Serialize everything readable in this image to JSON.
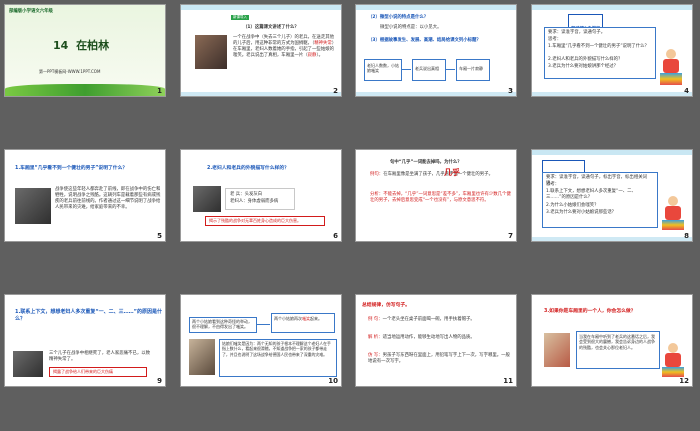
{
  "slides": [
    {
      "number": "1",
      "series": "部编版小学语文六年级",
      "lesson_num": "14",
      "lesson_title": "在柏林",
      "website": "第一PPT模板网-WWW.1PPT.COM"
    },
    {
      "number": "2",
      "tag": "新课导入",
      "question": "（1）这篇课文讲述了什么？",
      "body_a": "一个在战争中（失去三个儿子）的老兵，在送走其他的儿子后，用这种非常的方式为国捐躯，（",
      "body_b": "精神失常",
      "body_c": "）在车厢里，老妇人数着她的手指，引起了一些姑娘的嗤笑。老兵说出了真相，车厢里一片（",
      "body_d": "寂静",
      "body_e": "）。"
    },
    {
      "number": "3",
      "q1": "（2）微型小说的特点是什么？",
      "a1": "微型小说的特点是：以小见大。",
      "q2": "（3）根据故事发生、发展、高潮、结局给课文列小标题？",
      "flow": [
        "老妇人数数，小姑娘嗤笑",
        "老兵说出真相",
        "车厢一片寂静"
      ]
    },
    {
      "number": "4",
      "title": "朗读第1自然段",
      "lines": [
        "要求：读准字音，读通句子。",
        "思考：",
        "1.车厢里“几乎看不到一个健壮的男子”说明了什么？",
        "2.老妇人和老兵的外貌描写什么样的？",
        "3.老兵为什么要对姑娘讲那个经过？"
      ]
    },
    {
      "number": "5",
      "question": "1.车厢里“几乎看不到一个健壮的男子”说明了什么？",
      "answer": "战争使这些年轻人都奔赴了前线，即在战争中的伤亡和牺牲，说明战争之残酷。这辆列车是载着那些有病或残疾的老兵前往前线的。作者通过这一细节说明了战争给人民带来的灾难，给家庭带来的不幸。"
    },
    {
      "number": "6",
      "question": "2.老妇人和老兵的外貌描写什么样的？",
      "desc_a": "老  兵：头发灰白",
      "desc_b": "老妇人：身体虚弱而多病",
      "conclusion": "揭示了残酷的战争对无辜百姓身心造成的巨大伤害。"
    },
    {
      "number": "7",
      "question": "句中“几乎”一词能去掉吗，为什么？",
      "example_label": "例句：",
      "example": "在车厢里像是坐满了孩子，几乎看不到一个健壮的男子。",
      "keyword": "几乎",
      "analysis_label": "分析：",
      "analysis": "不能去掉，“几乎”一词意思是“差不多”，车厢里也许有少数几个健壮的男子，去掉后意思变成“一个也没有”，与原文意思不符。"
    },
    {
      "number": "8",
      "title": "朗读第2、3自然段",
      "lines": [
        "要求：读准字音，读通句子，标出字音，标出相关词语。",
        "思考：",
        "1.联系上下文，想想老妇人多次重复“一、二、三……”的原因是什么？",
        "2.为什么小姑娘们会嗤笑？",
        "3.老兵为什么要对小姑娘说那些话？"
      ]
    },
    {
      "number": "9",
      "question": "1.联系上下文，想想老妇人多次重复“一、二、三……”的原因是什么？",
      "answer": "三个儿子在战争中相继死了，老人家悲痛不已，以致精神失常了。",
      "conclusion": "揭露了战争给人们带来的巨大伤痛"
    },
    {
      "number": "10",
      "box1": "两个小姑娘看到这种奇怪的举动，很不理解，不由得发出了嗤笑。",
      "box2a": "两个小姑娘再次",
      "box2b": "嗤笑",
      "box2c": "起来。",
      "note": "姑娘们嗤笑是因为：两个无知的孩子根本不理解这个老妇人在手指上数什么，看起来很滑稽，不知道战争把一家的孩子都带走了，并且也说明了这场战争给德国人民也带来了深重的灾难。"
    },
    {
      "number": "11",
      "title": "总结规律，仿写句子。",
      "e1_label": "例  句：",
      "e1": "一个老头坐在桌子前面喝一碗，用手扶着帽子。",
      "e2_label": "解  析：",
      "e2": "适当地运用动作，能够生动地写出人物的品质。",
      "e3_label": "仿  写：",
      "e3": "男孩子写东西呀在里面上，用铅笔写字上下一次，写字哪里。一般地说有一次写字。"
    },
    {
      "number": "12",
      "question": "3.如果你是车厢里的一个人，你会怎么做？",
      "answer": "当我在车厢中听到了老兵的这番话之后，我会受到很大的震撼，我会告诉身边的人战争的残酷，也会关心那位老妇人。"
    }
  ],
  "colors": {
    "background": "#5f5f5f",
    "title_blue": "#1a57b8",
    "accent_red": "#d21b1b",
    "accent_green": "#2aa24a"
  }
}
